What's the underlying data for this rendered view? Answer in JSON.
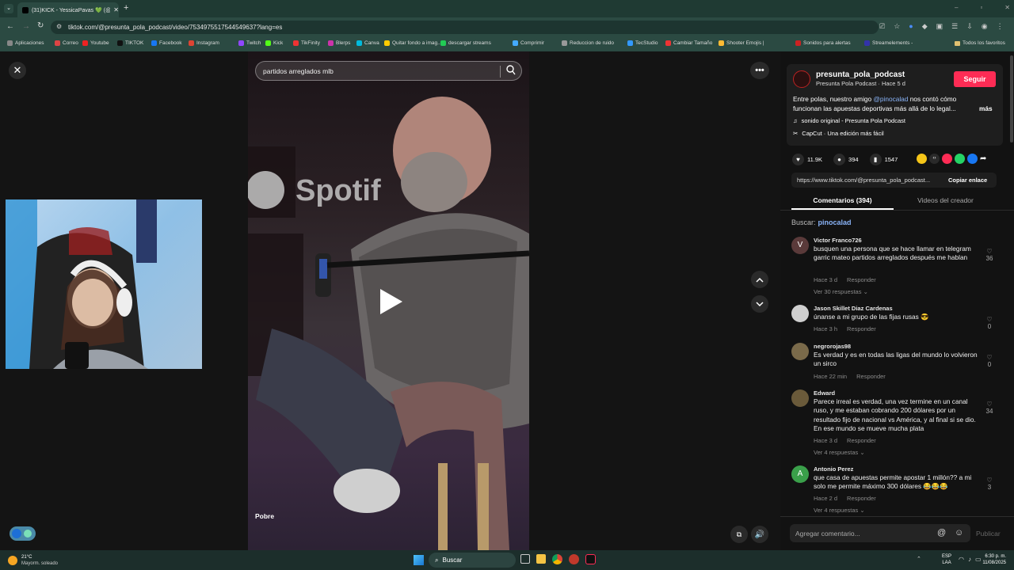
{
  "browser": {
    "tab_title": "(31)KICK - YessicaPavas 💚 (@",
    "new_tab": "+",
    "url": "tiktok.com/@presunta_pola_podcast/video/7534975517544549637?lang=es",
    "bookmarks": [
      {
        "label": "Aplicaciones",
        "color": "#888"
      },
      {
        "label": "Correo",
        "color": "#d44"
      },
      {
        "label": "Youtube",
        "color": "#e22"
      },
      {
        "label": "TIKTOK",
        "color": "#111"
      },
      {
        "label": "Facebook",
        "color": "#1877f2"
      },
      {
        "label": "Instagram",
        "color": "#d43"
      },
      {
        "label": "Twitch",
        "color": "#9146ff"
      },
      {
        "label": "Kick",
        "color": "#53fc18"
      },
      {
        "label": "TikFinity",
        "color": "#e33"
      },
      {
        "label": "Blerps",
        "color": "#c3a"
      },
      {
        "label": "Canva",
        "color": "#0bd"
      },
      {
        "label": "Quitar fondo a imag...",
        "color": "#fc0"
      },
      {
        "label": "descargar streams",
        "color": "#2c5"
      },
      {
        "label": "Comprimir",
        "color": "#4af"
      },
      {
        "label": "Reduccion de ruido",
        "color": "#999"
      },
      {
        "label": "TecStudio",
        "color": "#39f"
      },
      {
        "label": "Cambiar Tamaño",
        "color": "#e33"
      },
      {
        "label": "Shooter Emojis |",
        "color": "#fb3"
      },
      {
        "label": "Sonidos para alertas",
        "color": "#c22"
      },
      {
        "label": "Streamelements -",
        "color": "#33a"
      }
    ],
    "all_favorites": "Todos los favoritos"
  },
  "player": {
    "search_value": "partidos arreglados mlb",
    "caption": "Pobre"
  },
  "creator": {
    "username": "presunta_pola_podcast",
    "subtitle": "Presunta Pola Podcast · Hace 5 d",
    "follow_label": "Seguir",
    "desc_pre": "Entre polas, nuestro amigo ",
    "desc_mention": "@pinocalad",
    "desc_post": " nos contó cómo funcionan las apuestas deportivas más allá de lo legal...",
    "more": "más",
    "sound": "sonido original - Presunta Pola Podcast",
    "capcut": "CapCut · Una edición más fácil"
  },
  "stats": {
    "likes": "11.9K",
    "comments": "394",
    "saves": "1547"
  },
  "share": {
    "link": "https://www.tiktok.com/@presunta_pola_podcast...",
    "copy_label": "Copiar enlace"
  },
  "tabs": {
    "comments": "Comentarios (394)",
    "creator_videos": "Videos del creador"
  },
  "search_hint": {
    "label": "Buscar:",
    "term": "pinocalad"
  },
  "comments": [
    {
      "name": "Victor Franco726",
      "initial": "V",
      "avatar_color": "#5a3a3a",
      "text": "busquen una persona que se hace llamar en telegram garric mateo partidos arreglados después me hablan",
      "time": "Hace 3 d",
      "reply": "Responder",
      "likes": "36",
      "replies": "Ver 30 respuestas"
    },
    {
      "name": "Jason Skillet Diaz Cardenas",
      "initial": "",
      "avatar_color": "#cfcfcf",
      "text": "únanse a mi grupo de las fijas rusas 😎",
      "time": "Hace 3 h",
      "reply": "Responder",
      "likes": "0",
      "replies": ""
    },
    {
      "name": "negrorojas98",
      "initial": "",
      "avatar_color": "#7a6a4a",
      "text": "Es verdad y es en todas las ligas del mundo lo volvieron un sirco",
      "time": "Hace 22 min",
      "reply": "Responder",
      "likes": "0",
      "replies": ""
    },
    {
      "name": "Edward",
      "initial": "",
      "avatar_color": "#6a5a3a",
      "text": "Parece irreal es verdad, una vez termine en un canal ruso, y me estaban cobrando 200 dólares por un resultado fijo de nacional vs América, y al final si se dio. En ese mundo se mueve mucha plata",
      "time": "Hace 3 d",
      "reply": "Responder",
      "likes": "34",
      "replies": "Ver 4 respuestas"
    },
    {
      "name": "Antonio Perez",
      "initial": "A",
      "avatar_color": "#3aa04a",
      "text": "que casa de apuestas permite apostar 1 millón?? a mi solo me permite máximo 300 dólares 😂😂😂",
      "time": "Hace 2 d",
      "reply": "Responder",
      "likes": "3",
      "replies": "Ver 4 respuestas"
    }
  ],
  "composer": {
    "placeholder": "Agregar comentario...",
    "post": "Publicar"
  },
  "taskbar": {
    "weather_temp": "21°C",
    "weather_desc": "Mayorm. soleado",
    "search": "Buscar",
    "lang1": "ESP",
    "lang2": "LAA",
    "time": "6:30 p. m.",
    "date": "11/08/2025"
  }
}
